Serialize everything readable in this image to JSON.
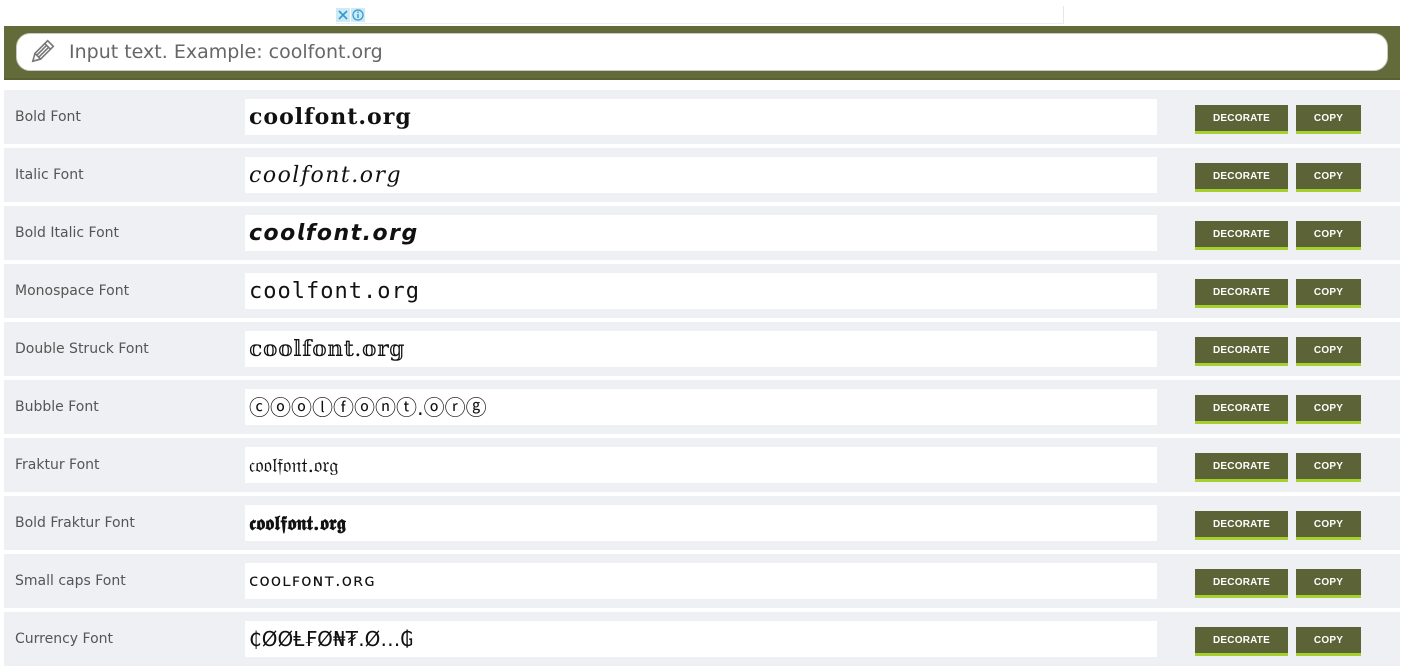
{
  "ad": {
    "close_icon": "close-icon",
    "info_icon": "info-icon"
  },
  "input": {
    "placeholder": "Input text. Example: coolfont.org",
    "icon": "pencil-icon"
  },
  "buttons": {
    "decorate_label": "DECORATE",
    "copy_label": "COPY"
  },
  "fonts": [
    {
      "label": "Bold Font",
      "output": "𝐜𝐨𝐨𝐥𝐟𝐨𝐧𝐭.𝐨𝐫𝐠"
    },
    {
      "label": "Italic Font",
      "output": "𝑐𝑜𝑜𝑙𝑓𝑜𝑛𝑡.𝑜𝑟𝑔"
    },
    {
      "label": "Bold Italic Font",
      "output": "𝙘𝙤𝙤𝙡𝙛𝙤𝙣𝙩.𝙤𝙧𝙜"
    },
    {
      "label": "Monospace Font",
      "output": "𝚌𝚘𝚘𝚕𝚏𝚘𝚗𝚝.𝚘𝚛𝚐"
    },
    {
      "label": "Double Struck Font",
      "output": "𝕔𝕠𝕠𝕝𝕗𝕠𝕟𝕥.𝕠𝕣𝕘"
    },
    {
      "label": "Bubble Font",
      "output": "ⓒⓞⓞⓛⓕⓞⓝⓣ.ⓞⓡⓖ"
    },
    {
      "label": "Fraktur Font",
      "output": "𝔠𝔬𝔬𝔩𝔣𝔬𝔫𝔱.𝔬𝔯𝔤"
    },
    {
      "label": "Bold Fraktur Font",
      "output": "𝖈𝖔𝖔𝖑𝖋𝖔𝖓𝖙.𝖔𝖗𝖌"
    },
    {
      "label": "Small caps Font",
      "output": "ᴄᴏᴏʟꜰᴏɴᴛ.ᴏʀɢ"
    },
    {
      "label": "Currency Font",
      "output": "₵ØØⱠ₣Ø₦₮.Ø…₲"
    }
  ],
  "colors": {
    "bar_olive": "#646b3a",
    "button_olive": "#5c6336",
    "button_accent": "#a6d02e",
    "row_bg": "#eff0f3"
  }
}
